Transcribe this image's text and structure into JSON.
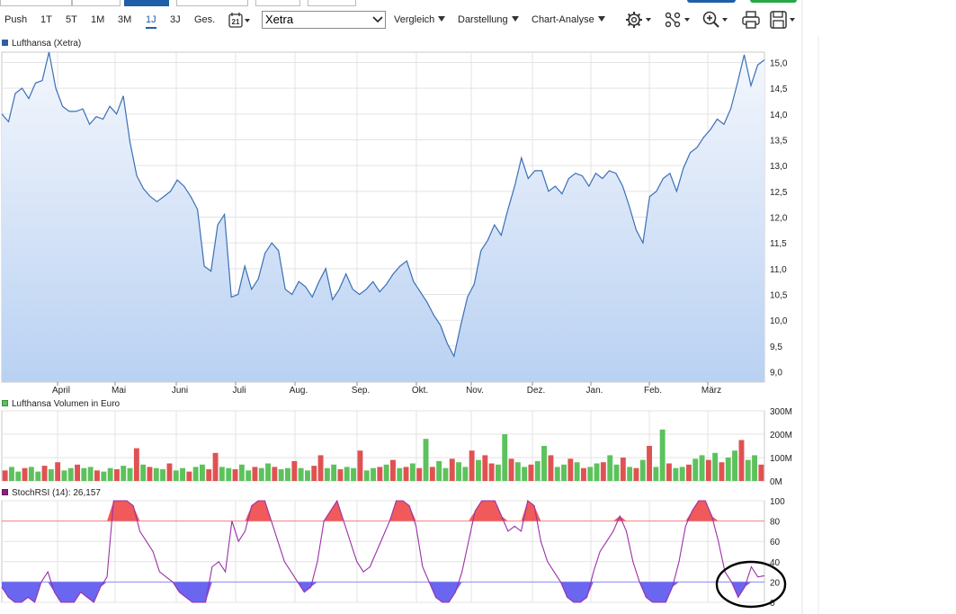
{
  "toolbar": {
    "ranges": [
      "Push",
      "1T",
      "5T",
      "1M",
      "3M",
      "1J",
      "3J",
      "Ges."
    ],
    "active_range": "1J",
    "exchange": "Xetra",
    "menus": [
      "Vergleich",
      "Darstellung",
      "Chart-Analyse"
    ],
    "icons": [
      "calendar-icon",
      "settings-icon",
      "indicators-icon",
      "zoom-icon",
      "print-icon",
      "save-icon"
    ]
  },
  "colors": {
    "price_line": "#3a6fb7",
    "volume_up": "#5cc25c",
    "volume_down": "#e05252",
    "stoch_line": "#9b30a8",
    "overbought_fill": "#f05a5a",
    "oversold_fill": "#6a66f0",
    "accent": "#1f5fa8"
  },
  "chart_data": [
    {
      "type": "line",
      "title": "Lufthansa (Xetra)",
      "x_labels": [
        "April",
        "Mai",
        "Juni",
        "Juli",
        "Aug.",
        "Sep.",
        "Okt.",
        "Nov.",
        "Dez.",
        "Jan.",
        "Feb.",
        "März"
      ],
      "y_ticks": [
        "15,0",
        "14,5",
        "14,0",
        "13,5",
        "13,0",
        "12,5",
        "12,0",
        "11,5",
        "11,0",
        "10,5",
        "10,0",
        "9,5",
        "9,0"
      ],
      "ylim": [
        8.8,
        15.2
      ],
      "series": [
        {
          "values": [
            14.0,
            13.85,
            14.4,
            14.5,
            14.3,
            14.6,
            14.65,
            15.2,
            14.5,
            14.15,
            14.05,
            14.05,
            14.1,
            13.8,
            13.95,
            13.9,
            14.15,
            14.0,
            14.35,
            13.45,
            12.8,
            12.55,
            12.4,
            12.3,
            12.4,
            12.5,
            12.72,
            12.6,
            12.4,
            12.15,
            11.05,
            10.95,
            11.85,
            12.05,
            10.45,
            10.5,
            11.05,
            10.6,
            10.8,
            11.3,
            11.5,
            11.35,
            10.6,
            10.5,
            10.75,
            10.65,
            10.45,
            10.75,
            11.0,
            10.4,
            10.6,
            10.9,
            10.6,
            10.5,
            10.6,
            10.75,
            10.55,
            10.7,
            10.9,
            11.05,
            11.15,
            10.75,
            10.55,
            10.35,
            10.1,
            9.9,
            9.55,
            9.3,
            9.9,
            10.45,
            10.7,
            11.35,
            11.55,
            11.85,
            11.65,
            12.15,
            12.6,
            13.15,
            12.75,
            12.9,
            12.9,
            12.5,
            12.6,
            12.45,
            12.75,
            12.85,
            12.8,
            12.6,
            12.85,
            12.75,
            12.9,
            12.85,
            12.6,
            12.2,
            11.75,
            11.5,
            12.4,
            12.5,
            12.75,
            12.85,
            12.5,
            12.95,
            13.25,
            13.35,
            13.55,
            13.7,
            13.9,
            13.8,
            14.1,
            14.6,
            15.15,
            14.55,
            14.95,
            15.05
          ]
        }
      ]
    },
    {
      "type": "bar",
      "title": "Lufthansa Volumen in Euro",
      "y_ticks": [
        "300M",
        "200M",
        "100M",
        "0M"
      ],
      "ylim": [
        0,
        300
      ],
      "values": [
        45,
        60,
        40,
        55,
        60,
        40,
        65,
        50,
        80,
        45,
        55,
        70,
        55,
        60,
        45,
        40,
        55,
        50,
        65,
        55,
        140,
        70,
        60,
        55,
        50,
        75,
        45,
        55,
        40,
        60,
        70,
        50,
        120,
        60,
        55,
        50,
        70,
        45,
        60,
        55,
        75,
        60,
        50,
        55,
        85,
        55,
        45,
        65,
        110,
        55,
        70,
        50,
        60,
        55,
        130,
        45,
        55,
        60,
        70,
        90,
        55,
        60,
        75,
        55,
        180,
        60,
        85,
        55,
        95,
        80,
        60,
        130,
        90,
        110,
        75,
        70,
        200,
        95,
        80,
        60,
        70,
        85,
        150,
        110,
        60,
        70,
        95,
        80,
        55,
        60,
        75,
        80,
        110,
        70,
        100,
        60,
        55,
        90,
        150,
        60,
        220,
        75,
        55,
        60,
        70,
        95,
        110,
        90,
        120,
        80,
        100,
        130,
        175,
        90,
        110,
        70
      ],
      "colors": [
        "down",
        "up",
        "up",
        "down",
        "up",
        "up",
        "down",
        "up",
        "down",
        "up",
        "up",
        "down",
        "up",
        "up",
        "down",
        "up",
        "up",
        "down",
        "up",
        "up",
        "down",
        "up",
        "down",
        "up",
        "up",
        "down",
        "up",
        "up",
        "down",
        "up",
        "up",
        "down",
        "down",
        "up",
        "up",
        "down",
        "up",
        "up",
        "down",
        "up",
        "up",
        "down",
        "up",
        "up",
        "down",
        "up",
        "up",
        "down",
        "down",
        "up",
        "up",
        "down",
        "up",
        "up",
        "down",
        "up",
        "up",
        "down",
        "up",
        "down",
        "up",
        "down",
        "up",
        "down",
        "up",
        "down",
        "up",
        "up",
        "down",
        "up",
        "up",
        "down",
        "up",
        "down",
        "down",
        "up",
        "up",
        "down",
        "up",
        "up",
        "down",
        "up",
        "up",
        "down",
        "up",
        "up",
        "down",
        "up",
        "down",
        "up",
        "up",
        "down",
        "up",
        "up",
        "down",
        "up",
        "down",
        "up",
        "down",
        "up",
        "up",
        "down",
        "up",
        "up",
        "down",
        "up",
        "up",
        "down",
        "up",
        "down",
        "up",
        "up",
        "down",
        "up",
        "up",
        "down"
      ]
    },
    {
      "type": "line",
      "title": "StochRSI (14): 26,157",
      "y_ticks": [
        "100",
        "80",
        "60",
        "40",
        "20",
        "0"
      ],
      "reference_lines": [
        80,
        20
      ],
      "ylim": [
        0,
        100
      ],
      "series": [
        {
          "values": [
            15,
            5,
            0,
            0,
            5,
            0,
            20,
            30,
            10,
            0,
            0,
            0,
            10,
            5,
            0,
            15,
            25,
            100,
            100,
            100,
            95,
            70,
            60,
            50,
            30,
            25,
            20,
            10,
            5,
            0,
            0,
            0,
            35,
            40,
            30,
            80,
            60,
            70,
            95,
            100,
            100,
            80,
            60,
            40,
            30,
            20,
            10,
            15,
            40,
            80,
            90,
            100,
            80,
            60,
            40,
            30,
            35,
            50,
            65,
            80,
            100,
            100,
            95,
            75,
            35,
            20,
            5,
            0,
            0,
            10,
            30,
            60,
            90,
            100,
            100,
            100,
            85,
            70,
            75,
            70,
            100,
            95,
            60,
            40,
            30,
            20,
            5,
            0,
            0,
            5,
            30,
            50,
            60,
            70,
            85,
            70,
            40,
            20,
            5,
            0,
            0,
            0,
            15,
            40,
            75,
            90,
            100,
            100,
            85,
            60,
            30,
            20,
            5,
            15,
            35,
            25,
            26.157
          ]
        }
      ]
    }
  ]
}
